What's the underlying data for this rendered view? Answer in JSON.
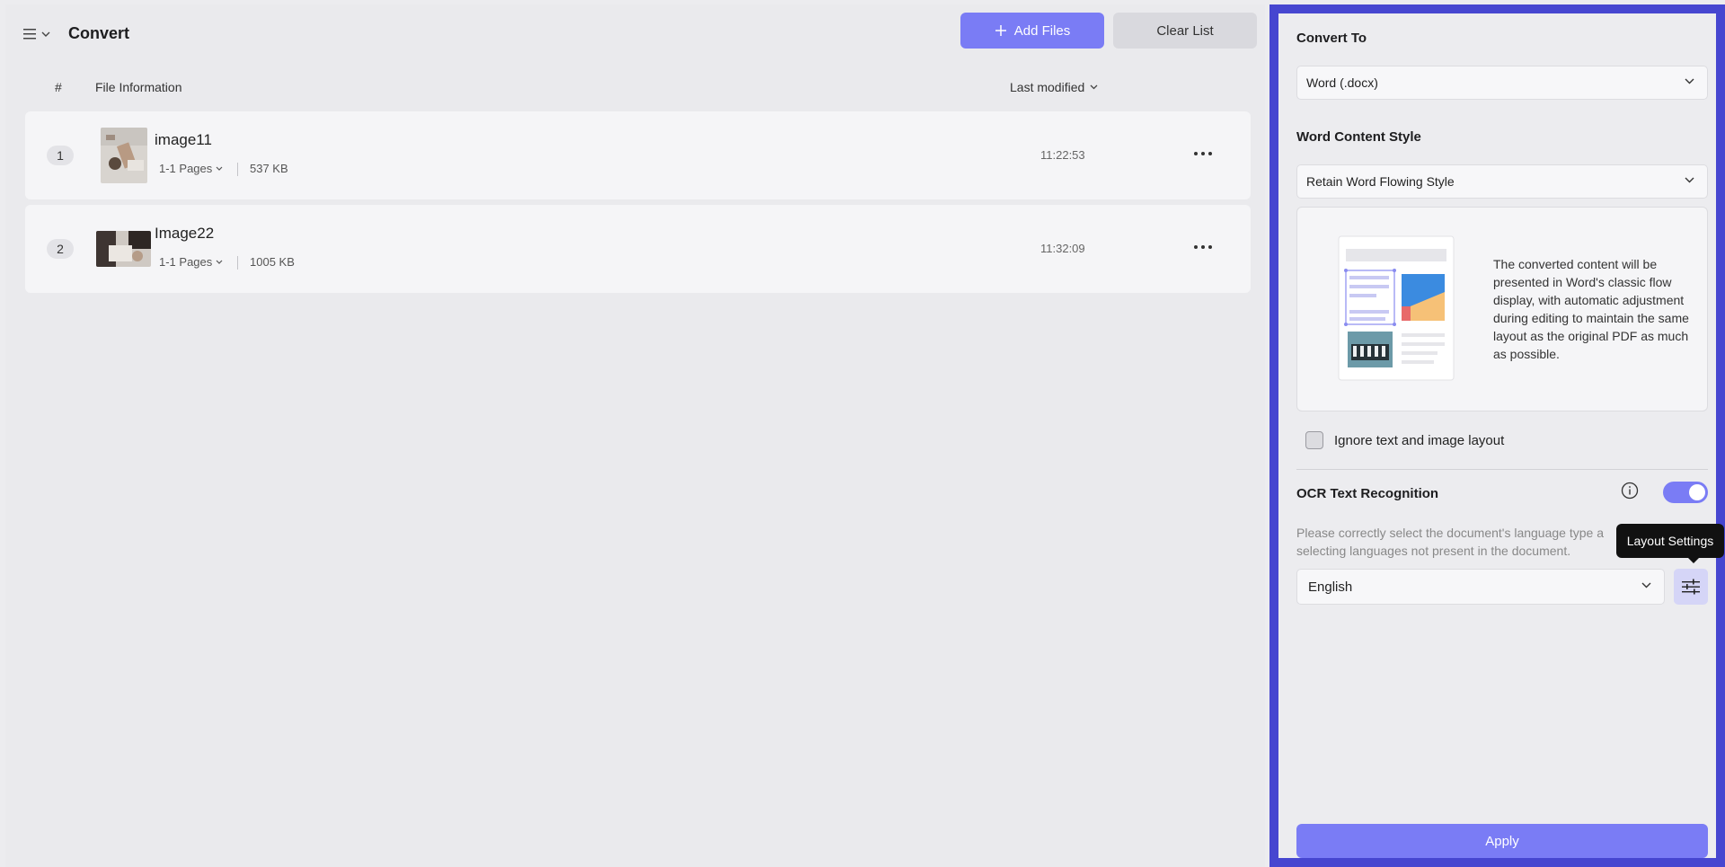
{
  "header": {
    "title": "Convert",
    "add_files_label": "Add Files",
    "clear_list_label": "Clear List"
  },
  "list": {
    "col_index": "#",
    "col_info": "File Information",
    "sort_label": "Last modified",
    "files": [
      {
        "index": "1",
        "name": "image11",
        "pages": "1-1 Pages",
        "size": "537 KB",
        "time": "11:22:53"
      },
      {
        "index": "2",
        "name": "Image22",
        "pages": "1-1 Pages",
        "size": "1005 KB",
        "time": "11:32:09"
      }
    ]
  },
  "panel": {
    "convert_to_label": "Convert To",
    "convert_to_value": "Word (.docx)",
    "content_style_label": "Word Content Style",
    "content_style_value": "Retain Word Flowing Style",
    "style_description": "The converted content will be presented in Word's classic flow display, with automatic adjustment during editing to maintain the same layout as the original PDF as much as possible.",
    "ignore_layout_label": "Ignore text and image layout",
    "ignore_layout_checked": false,
    "ocr_label": "OCR Text Recognition",
    "ocr_enabled": true,
    "ocr_description": "Please correctly select the document's language type a selecting languages not present in the document.",
    "language_value": "English",
    "layout_tooltip": "Layout Settings",
    "apply_label": "Apply"
  },
  "colors": {
    "accent": "#7a7cf5",
    "panel_border": "#4646d0"
  }
}
